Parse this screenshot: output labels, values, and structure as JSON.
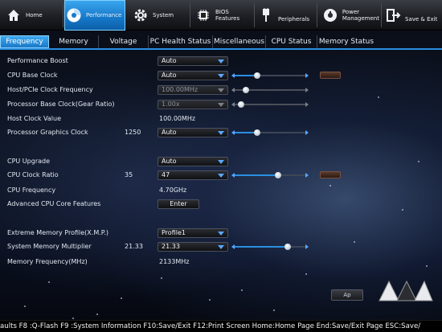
{
  "nav": {
    "home": "Home",
    "performance": "Performance",
    "system": "System",
    "bios_features_1": "BIOS",
    "bios_features_2": "Features",
    "peripherals": "Peripherals",
    "power_management_1": "Power",
    "power_management_2": "Management",
    "save_exit": "Save & Exit"
  },
  "tabs": [
    "Frequency",
    "Memory",
    "Voltage",
    "PC Health Status",
    "Miscellaneous",
    "CPU Status",
    "Memory Status"
  ],
  "settings": {
    "performance_boost": {
      "label": "Performance Boost",
      "value": "Auto"
    },
    "cpu_base_clock": {
      "label": "CPU Base Clock",
      "value": "Auto",
      "slider_level": 0.3
    },
    "host_pcie_clock": {
      "label": "Host/PCIe Clock Frequency",
      "value": "100.00MHz",
      "slider_level": 0.12
    },
    "processor_base_clock": {
      "label": "Processor Base Clock(Gear Ratio)",
      "value": "1.00x",
      "slider_level": 0.05
    },
    "host_clock_value": {
      "label": "Host Clock Value",
      "value": "100.00MHz"
    },
    "processor_graphics_clock": {
      "label": "Processor Graphics Clock",
      "current": "1250",
      "value": "Auto",
      "slider_level": 0.3
    },
    "cpu_upgrade": {
      "label": "CPU Upgrade",
      "value": "Auto"
    },
    "cpu_clock_ratio": {
      "label": "CPU Clock Ratio",
      "current": "35",
      "value": "47",
      "slider_level": 0.62
    },
    "cpu_frequency": {
      "label": "CPU Frequency",
      "value": "4.70GHz"
    },
    "advanced_cpu_core": {
      "label": "Advanced CPU Core Features",
      "button": "Enter"
    },
    "xmp": {
      "label": "Extreme Memory Profile(X.M.P.)",
      "value": "Profile1"
    },
    "system_memory_multiplier": {
      "label": "System Memory Multiplier",
      "current": "21.33",
      "value": "21.33",
      "slider_level": 0.78
    },
    "memory_frequency": {
      "label": "Memory Frequency(MHz)",
      "value": "2133MHz"
    }
  },
  "apply_button": "Ap",
  "status_bar": "aults F8 :Q-Flash F9 :System Information F10:Save/Exit F12:Print Screen Home:Home Page End:Save/Exit Page ESC:Save/",
  "colors": {
    "accent": "#2a8fe0",
    "active_tab": "#1a78c8",
    "text": "#e3e9f1"
  }
}
